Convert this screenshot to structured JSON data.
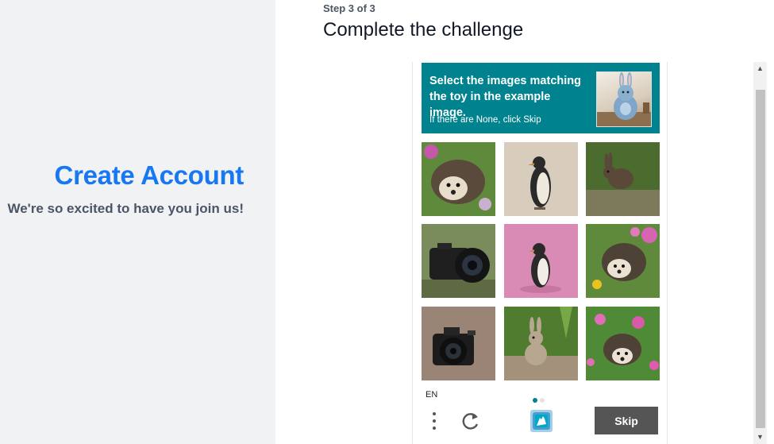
{
  "left_panel": {
    "title": "Create Account",
    "subtitle": "We're so excited to have you join us!",
    "title_color": "#1877f2"
  },
  "main": {
    "step": "Step 3 of 3",
    "title": "Complete the challenge"
  },
  "captcha": {
    "prompt": "Select the images matching the toy in the example image.",
    "hint": "If there are None, click Skip",
    "prompt_bg": "#00838f",
    "example_image": "toy-bunny",
    "tiles": [
      {
        "subject": "hedgehog"
      },
      {
        "subject": "penguin"
      },
      {
        "subject": "rabbit"
      },
      {
        "subject": "camera"
      },
      {
        "subject": "penguin"
      },
      {
        "subject": "hedgehog"
      },
      {
        "subject": "camera"
      },
      {
        "subject": "rabbit"
      },
      {
        "subject": "hedgehog"
      }
    ],
    "language": "EN",
    "skip_label": "Skip",
    "menu_icon": "more-vertical-icon",
    "refresh_icon": "refresh-icon",
    "logo_icon": "hcaptcha-logo-icon"
  },
  "scrollbar": {
    "up_arrow": "▲",
    "down_arrow": "▼"
  }
}
